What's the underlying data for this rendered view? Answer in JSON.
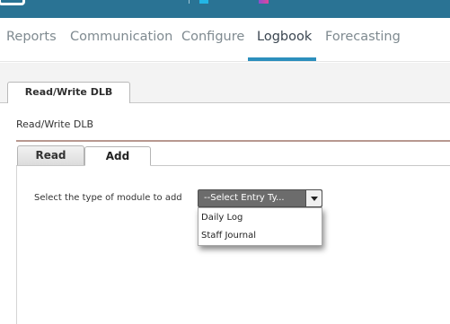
{
  "header": {
    "accent_colors": [
      "#2a7394",
      "#23b6e6",
      "#8a4fd0",
      "#e0469a"
    ]
  },
  "nav": {
    "items": [
      {
        "label": "Reports"
      },
      {
        "label": "Communication"
      },
      {
        "label": "Configure"
      },
      {
        "label": "Logbook"
      },
      {
        "label": "Forecasting"
      }
    ],
    "active": "Logbook"
  },
  "page": {
    "outer_tab": "Read/Write DLB",
    "section_title": "Read/Write DLB"
  },
  "inner_tabs": [
    {
      "label": "Read"
    },
    {
      "label": "Add"
    }
  ],
  "active_inner_tab": "Add",
  "module_select": {
    "label": "Select the type of module to add",
    "selected": "--Select Entry Ty...",
    "options": [
      "Daily Log",
      "Staff Journal"
    ],
    "arrow_icon": "chevron-down-icon"
  }
}
